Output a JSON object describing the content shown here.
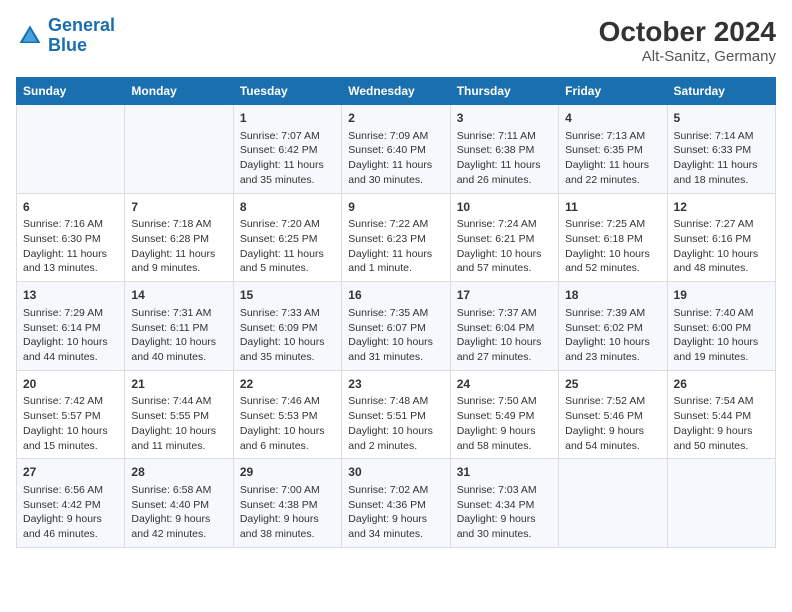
{
  "header": {
    "logo_line1": "General",
    "logo_line2": "Blue",
    "title": "October 2024",
    "subtitle": "Alt-Sanitz, Germany"
  },
  "days_of_week": [
    "Sunday",
    "Monday",
    "Tuesday",
    "Wednesday",
    "Thursday",
    "Friday",
    "Saturday"
  ],
  "weeks": [
    [
      {
        "day": "",
        "content": ""
      },
      {
        "day": "",
        "content": ""
      },
      {
        "day": "1",
        "content": "Sunrise: 7:07 AM\nSunset: 6:42 PM\nDaylight: 11 hours and 35 minutes."
      },
      {
        "day": "2",
        "content": "Sunrise: 7:09 AM\nSunset: 6:40 PM\nDaylight: 11 hours and 30 minutes."
      },
      {
        "day": "3",
        "content": "Sunrise: 7:11 AM\nSunset: 6:38 PM\nDaylight: 11 hours and 26 minutes."
      },
      {
        "day": "4",
        "content": "Sunrise: 7:13 AM\nSunset: 6:35 PM\nDaylight: 11 hours and 22 minutes."
      },
      {
        "day": "5",
        "content": "Sunrise: 7:14 AM\nSunset: 6:33 PM\nDaylight: 11 hours and 18 minutes."
      }
    ],
    [
      {
        "day": "6",
        "content": "Sunrise: 7:16 AM\nSunset: 6:30 PM\nDaylight: 11 hours and 13 minutes."
      },
      {
        "day": "7",
        "content": "Sunrise: 7:18 AM\nSunset: 6:28 PM\nDaylight: 11 hours and 9 minutes."
      },
      {
        "day": "8",
        "content": "Sunrise: 7:20 AM\nSunset: 6:25 PM\nDaylight: 11 hours and 5 minutes."
      },
      {
        "day": "9",
        "content": "Sunrise: 7:22 AM\nSunset: 6:23 PM\nDaylight: 11 hours and 1 minute."
      },
      {
        "day": "10",
        "content": "Sunrise: 7:24 AM\nSunset: 6:21 PM\nDaylight: 10 hours and 57 minutes."
      },
      {
        "day": "11",
        "content": "Sunrise: 7:25 AM\nSunset: 6:18 PM\nDaylight: 10 hours and 52 minutes."
      },
      {
        "day": "12",
        "content": "Sunrise: 7:27 AM\nSunset: 6:16 PM\nDaylight: 10 hours and 48 minutes."
      }
    ],
    [
      {
        "day": "13",
        "content": "Sunrise: 7:29 AM\nSunset: 6:14 PM\nDaylight: 10 hours and 44 minutes."
      },
      {
        "day": "14",
        "content": "Sunrise: 7:31 AM\nSunset: 6:11 PM\nDaylight: 10 hours and 40 minutes."
      },
      {
        "day": "15",
        "content": "Sunrise: 7:33 AM\nSunset: 6:09 PM\nDaylight: 10 hours and 35 minutes."
      },
      {
        "day": "16",
        "content": "Sunrise: 7:35 AM\nSunset: 6:07 PM\nDaylight: 10 hours and 31 minutes."
      },
      {
        "day": "17",
        "content": "Sunrise: 7:37 AM\nSunset: 6:04 PM\nDaylight: 10 hours and 27 minutes."
      },
      {
        "day": "18",
        "content": "Sunrise: 7:39 AM\nSunset: 6:02 PM\nDaylight: 10 hours and 23 minutes."
      },
      {
        "day": "19",
        "content": "Sunrise: 7:40 AM\nSunset: 6:00 PM\nDaylight: 10 hours and 19 minutes."
      }
    ],
    [
      {
        "day": "20",
        "content": "Sunrise: 7:42 AM\nSunset: 5:57 PM\nDaylight: 10 hours and 15 minutes."
      },
      {
        "day": "21",
        "content": "Sunrise: 7:44 AM\nSunset: 5:55 PM\nDaylight: 10 hours and 11 minutes."
      },
      {
        "day": "22",
        "content": "Sunrise: 7:46 AM\nSunset: 5:53 PM\nDaylight: 10 hours and 6 minutes."
      },
      {
        "day": "23",
        "content": "Sunrise: 7:48 AM\nSunset: 5:51 PM\nDaylight: 10 hours and 2 minutes."
      },
      {
        "day": "24",
        "content": "Sunrise: 7:50 AM\nSunset: 5:49 PM\nDaylight: 9 hours and 58 minutes."
      },
      {
        "day": "25",
        "content": "Sunrise: 7:52 AM\nSunset: 5:46 PM\nDaylight: 9 hours and 54 minutes."
      },
      {
        "day": "26",
        "content": "Sunrise: 7:54 AM\nSunset: 5:44 PM\nDaylight: 9 hours and 50 minutes."
      }
    ],
    [
      {
        "day": "27",
        "content": "Sunrise: 6:56 AM\nSunset: 4:42 PM\nDaylight: 9 hours and 46 minutes."
      },
      {
        "day": "28",
        "content": "Sunrise: 6:58 AM\nSunset: 4:40 PM\nDaylight: 9 hours and 42 minutes."
      },
      {
        "day": "29",
        "content": "Sunrise: 7:00 AM\nSunset: 4:38 PM\nDaylight: 9 hours and 38 minutes."
      },
      {
        "day": "30",
        "content": "Sunrise: 7:02 AM\nSunset: 4:36 PM\nDaylight: 9 hours and 34 minutes."
      },
      {
        "day": "31",
        "content": "Sunrise: 7:03 AM\nSunset: 4:34 PM\nDaylight: 9 hours and 30 minutes."
      },
      {
        "day": "",
        "content": ""
      },
      {
        "day": "",
        "content": ""
      }
    ]
  ]
}
